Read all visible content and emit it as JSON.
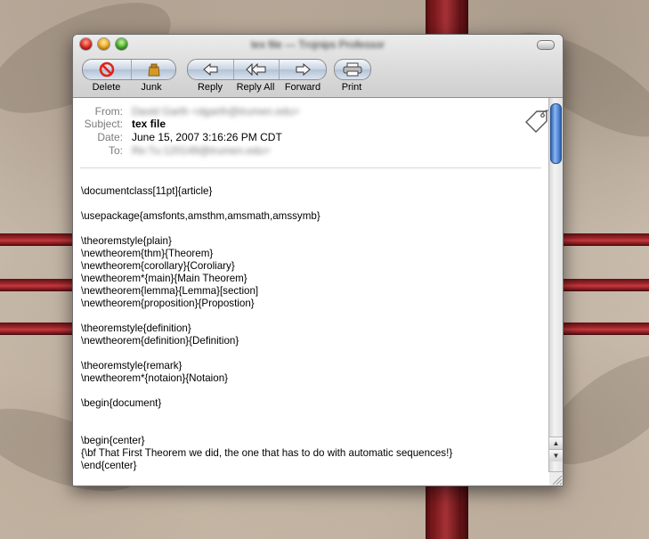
{
  "window": {
    "title": "tex file — Trojnips Professor"
  },
  "toolbar": {
    "delete_label": "Delete",
    "junk_label": "Junk",
    "reply_label": "Reply",
    "reply_all_label": "Reply All",
    "forward_label": "Forward",
    "print_label": "Print"
  },
  "header": {
    "from_label": "From:",
    "from_value": "David Garth <dgarth@trumen.edu>",
    "subject_label": "Subject:",
    "subject_value": "tex file",
    "date_label": "Date:",
    "date_value": "June 15, 2007 3:16:26 PM CDT",
    "to_label": "To:",
    "to_value": "Re:Tu:120149@trumen.edu>"
  },
  "body_lines": [
    "\\documentclass[11pt]{article}",
    "",
    "\\usepackage{amsfonts,amsthm,amsmath,amssymb}",
    "",
    "\\theoremstyle{plain}",
    "\\newtheorem{thm}{Theorem}",
    "\\newtheorem{corollary}{Coroliary}",
    "\\newtheorem*{main}{Main Theorem}",
    "\\newtheorem{lemma}{Lemma}[section]",
    "\\newtheorem{proposition}{Propostion}",
    "",
    "\\theoremstyle{definition}",
    "\\newtheorem{definition}{Definition}",
    "",
    "\\theoremstyle{remark}",
    "\\newtheorem*{notaion}{Notaion}",
    "",
    "\\begin{document}",
    "",
    "",
    "\\begin{center}",
    "{\\bf That First Theorem we did, the one that has to do with automatic sequences!}",
    "\\end{center}"
  ],
  "icons": {
    "delete": "no-entry-icon",
    "junk": "junk-bag-icon",
    "reply": "reply-arrow-icon",
    "reply_all": "reply-all-arrow-icon",
    "forward": "forward-arrow-icon",
    "print": "printer-icon",
    "tag": "price-tag-icon"
  },
  "colors": {
    "delete_red": "#e0241a",
    "scroll_blue": "#5a8fd8",
    "frame_red": "#a2262b"
  }
}
